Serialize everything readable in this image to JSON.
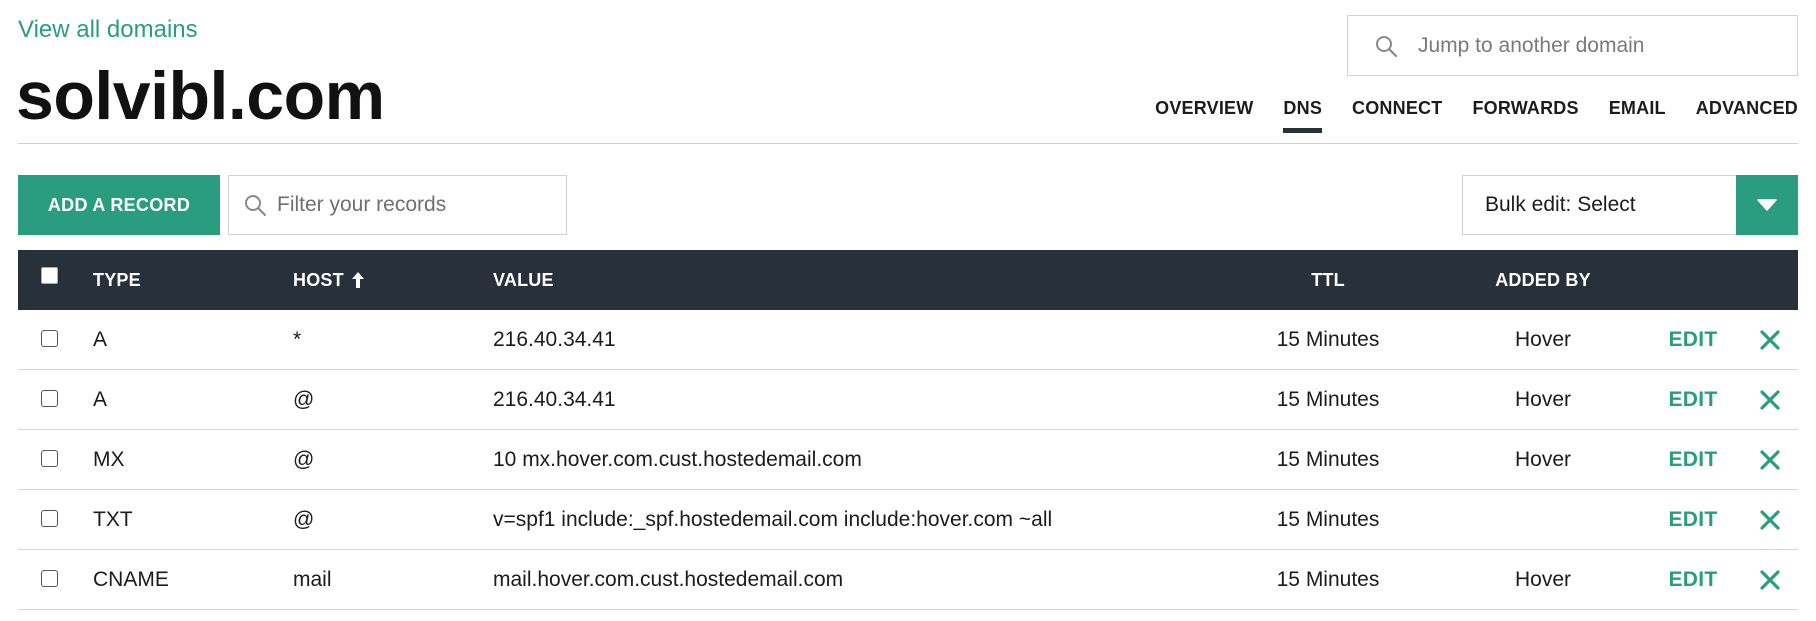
{
  "header": {
    "view_all_link": "View all domains",
    "domain": "solvibl.com",
    "jump_placeholder": "Jump to another domain"
  },
  "tabs": [
    {
      "label": "OVERVIEW",
      "active": false
    },
    {
      "label": "DNS",
      "active": true
    },
    {
      "label": "CONNECT",
      "active": false
    },
    {
      "label": "FORWARDS",
      "active": false
    },
    {
      "label": "EMAIL",
      "active": false
    },
    {
      "label": "ADVANCED",
      "active": false
    }
  ],
  "toolbar": {
    "add_record_label": "ADD A RECORD",
    "filter_placeholder": "Filter your records",
    "bulk_edit_label": "Bulk edit: Select"
  },
  "table": {
    "columns": {
      "type": "TYPE",
      "host": "HOST",
      "host_sort_icon": "arrow-up-icon",
      "value": "VALUE",
      "ttl": "TTL",
      "added_by": "ADDED BY"
    },
    "edit_label": "EDIT",
    "rows": [
      {
        "type": "A",
        "host": "*",
        "value": "216.40.34.41",
        "ttl": "15 Minutes",
        "added_by": "Hover"
      },
      {
        "type": "A",
        "host": "@",
        "value": "216.40.34.41",
        "ttl": "15 Minutes",
        "added_by": "Hover"
      },
      {
        "type": "MX",
        "host": "@",
        "value": "10 mx.hover.com.cust.hostedemail.com",
        "ttl": "15 Minutes",
        "added_by": "Hover"
      },
      {
        "type": "TXT",
        "host": "@",
        "value": "v=spf1 include:_spf.hostedemail.com include:hover.com ~all",
        "ttl": "15 Minutes",
        "added_by": ""
      },
      {
        "type": "CNAME",
        "host": "mail",
        "value": "mail.hover.com.cust.hostedemail.com",
        "ttl": "15 Minutes",
        "added_by": "Hover"
      }
    ]
  },
  "colors": {
    "accent": "#2a9d80",
    "header_bg": "#28303a",
    "border": "#d6d6d6"
  }
}
